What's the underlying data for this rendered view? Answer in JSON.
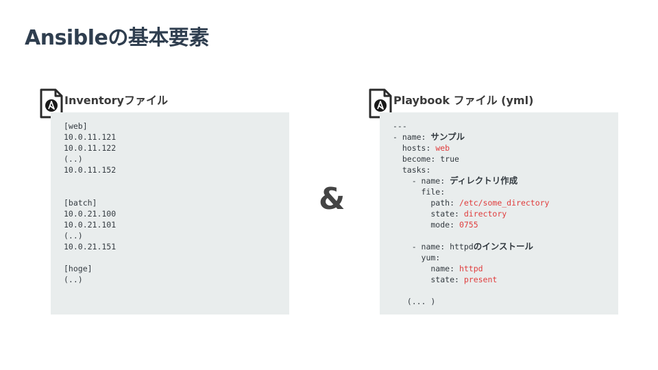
{
  "slide": {
    "title": "Ansibleの基本要素"
  },
  "inventory": {
    "label": "Inventoryファイル",
    "icon": "ansible-file-icon",
    "lines": [
      "[web]",
      "10.0.11.121",
      "10.0.11.122",
      "(..)",
      "10.0.11.152",
      "",
      "",
      "[batch]",
      "10.0.21.100",
      "10.0.21.101",
      "(..)",
      "10.0.21.151",
      "",
      "[hoge]",
      "(..)"
    ]
  },
  "ampersand": "&",
  "playbook": {
    "label": "Playbook ファイル (yml)",
    "icon": "ansible-file-icon",
    "lines": {
      "l1": "---",
      "l2_key": "- name: ",
      "l2_val": "サンプル",
      "l3_key": "  hosts: ",
      "l3_val": "web",
      "l4": "  become: true",
      "l5": "  tasks:",
      "l6_key": "    - name: ",
      "l6_val": "ディレクトリ作成",
      "l7": "      file:",
      "l8_key": "        path: ",
      "l8_val": "/etc/some_directory",
      "l9_key": "        state: ",
      "l9_val": "directory",
      "l10_key": "        mode: ",
      "l10_val": "0755",
      "l12_key": "    - name: httpd",
      "l12_val": "のインストール",
      "l13": "      yum:",
      "l14_key": "        name: ",
      "l14_val": "httpd",
      "l15_key": "        state: ",
      "l15_val": "present",
      "l17": "   (... )"
    }
  },
  "colors": {
    "title": "#2f3e4f",
    "code_bg": "#e9eded",
    "value_red": "#e03c3c"
  }
}
